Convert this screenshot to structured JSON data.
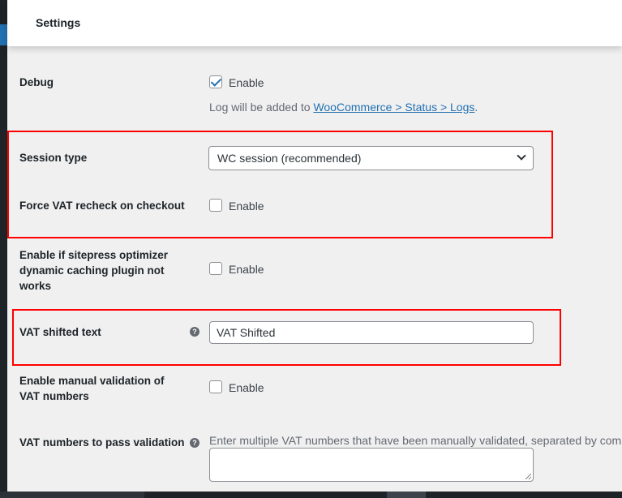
{
  "header": {
    "title": "Settings"
  },
  "debug": {
    "label": "Debug",
    "checked": true,
    "checkbox_label": "Enable",
    "desc_prefix": "Log will be added to ",
    "desc_link": "WooCommerce > Status > Logs",
    "desc_suffix": "."
  },
  "session_type": {
    "label": "Session type",
    "value": "WC session (recommended)"
  },
  "force_vat": {
    "label": "Force VAT recheck on checkout",
    "checked": false,
    "checkbox_label": "Enable"
  },
  "sitepress": {
    "label": "Enable if sitepress optimizer dynamic caching plugin not works",
    "checked": false,
    "checkbox_label": "Enable"
  },
  "vat_shifted": {
    "label": "VAT shifted text",
    "value": "VAT Shifted",
    "help": "?"
  },
  "manual_validation": {
    "label": "Enable manual validation of VAT numbers",
    "checked": false,
    "checkbox_label": "Enable"
  },
  "vat_numbers": {
    "label": "VAT numbers to pass validation",
    "help": "?",
    "desc": "Enter multiple VAT numbers that have been manually validated, separated by commas",
    "value": ""
  },
  "colors": {
    "accent": "#2271b1",
    "highlight": "#ff0000"
  }
}
